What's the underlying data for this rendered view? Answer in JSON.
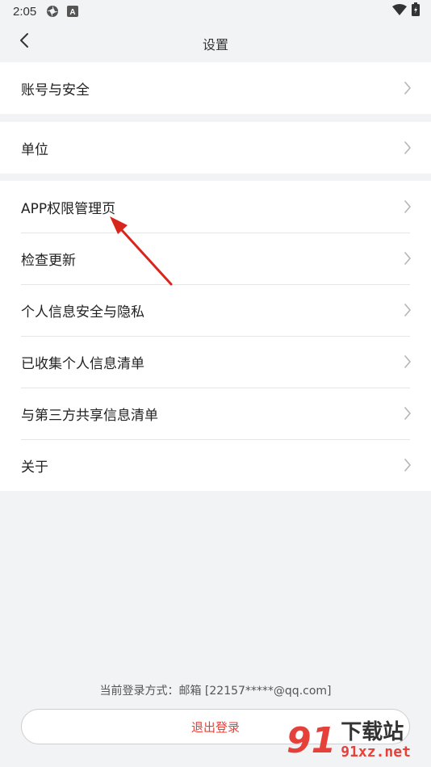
{
  "status_bar": {
    "time": "2:05",
    "icons": [
      "spinner-icon",
      "a-badge-icon",
      "wifi-icon",
      "battery-icon"
    ]
  },
  "nav": {
    "title": "设置",
    "back_icon": "chevron-left-icon"
  },
  "groups": [
    {
      "items": [
        {
          "label": "账号与安全"
        }
      ]
    },
    {
      "items": [
        {
          "label": "单位"
        }
      ]
    },
    {
      "items": [
        {
          "label": "APP权限管理页"
        },
        {
          "label": "检查更新"
        },
        {
          "label": "个人信息安全与隐私"
        },
        {
          "label": "已收集个人信息清单"
        },
        {
          "label": "与第三方共享信息清单"
        },
        {
          "label": "关于"
        }
      ]
    }
  ],
  "footer": {
    "login_info": "当前登录方式：邮箱 [22157*****@qq.com]",
    "logout_label": "退出登录"
  },
  "watermark": {
    "logo": "91",
    "name": "下载站",
    "url": "91xz.net"
  },
  "colors": {
    "background": "#f2f3f5",
    "accent": "#e5413a",
    "annotation": "#d9261c"
  }
}
